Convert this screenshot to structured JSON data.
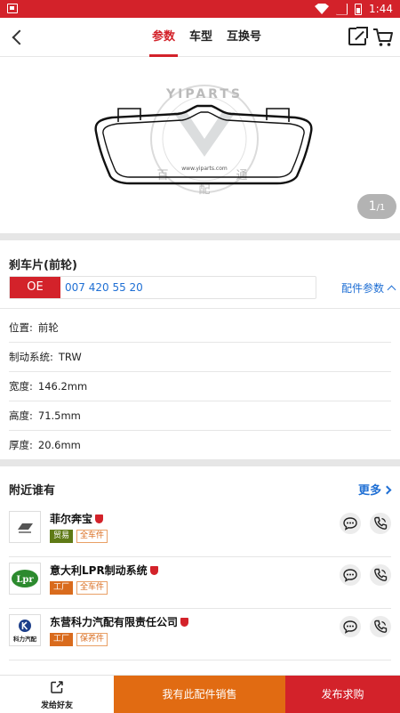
{
  "status_bar": {
    "time": "1:44"
  },
  "header": {
    "tabs": [
      {
        "label": "参数",
        "active": true
      },
      {
        "label": "车型",
        "active": false
      },
      {
        "label": "互换号",
        "active": false
      }
    ]
  },
  "hero": {
    "watermark_top": "YIPARTS",
    "watermark_url": "www.yiparts.com",
    "watermark_left": "百",
    "watermark_bottom": "配",
    "watermark_right": "通",
    "counter_current": "1",
    "counter_total": "1"
  },
  "part": {
    "title": "刹车片(前轮)",
    "oe_label": "OE",
    "oe_number": "007 420 55 20",
    "params_link": "配件参数"
  },
  "specs": [
    {
      "key": "位置:",
      "value": "前轮"
    },
    {
      "key": "制动系统:",
      "value": "TRW"
    },
    {
      "key": "宽度:",
      "value": "146.2mm"
    },
    {
      "key": "高度:",
      "value": "71.5mm"
    },
    {
      "key": "厚度:",
      "value": "20.6mm"
    }
  ],
  "nearby": {
    "title": "附近谁有",
    "more": "更多",
    "shops": [
      {
        "name": "菲尔奔宝",
        "tags": [
          "贸易",
          "全车件"
        ],
        "logo_text": ""
      },
      {
        "name": "意大利LPR制动系统",
        "tags": [
          "工厂",
          "全车件"
        ],
        "logo_text": "Lpr"
      },
      {
        "name": "东营科力汽配有限责任公司",
        "tags": [
          "工厂",
          "保养件"
        ],
        "logo_text": "科力汽配"
      }
    ]
  },
  "bottom": {
    "send_friend": "发给好友",
    "sell": "我有此配件销售",
    "buy": "发布求购"
  },
  "colors": {
    "brand_red": "#d3222a",
    "link_blue": "#1f6fd4",
    "sell_orange": "#e16b12"
  }
}
